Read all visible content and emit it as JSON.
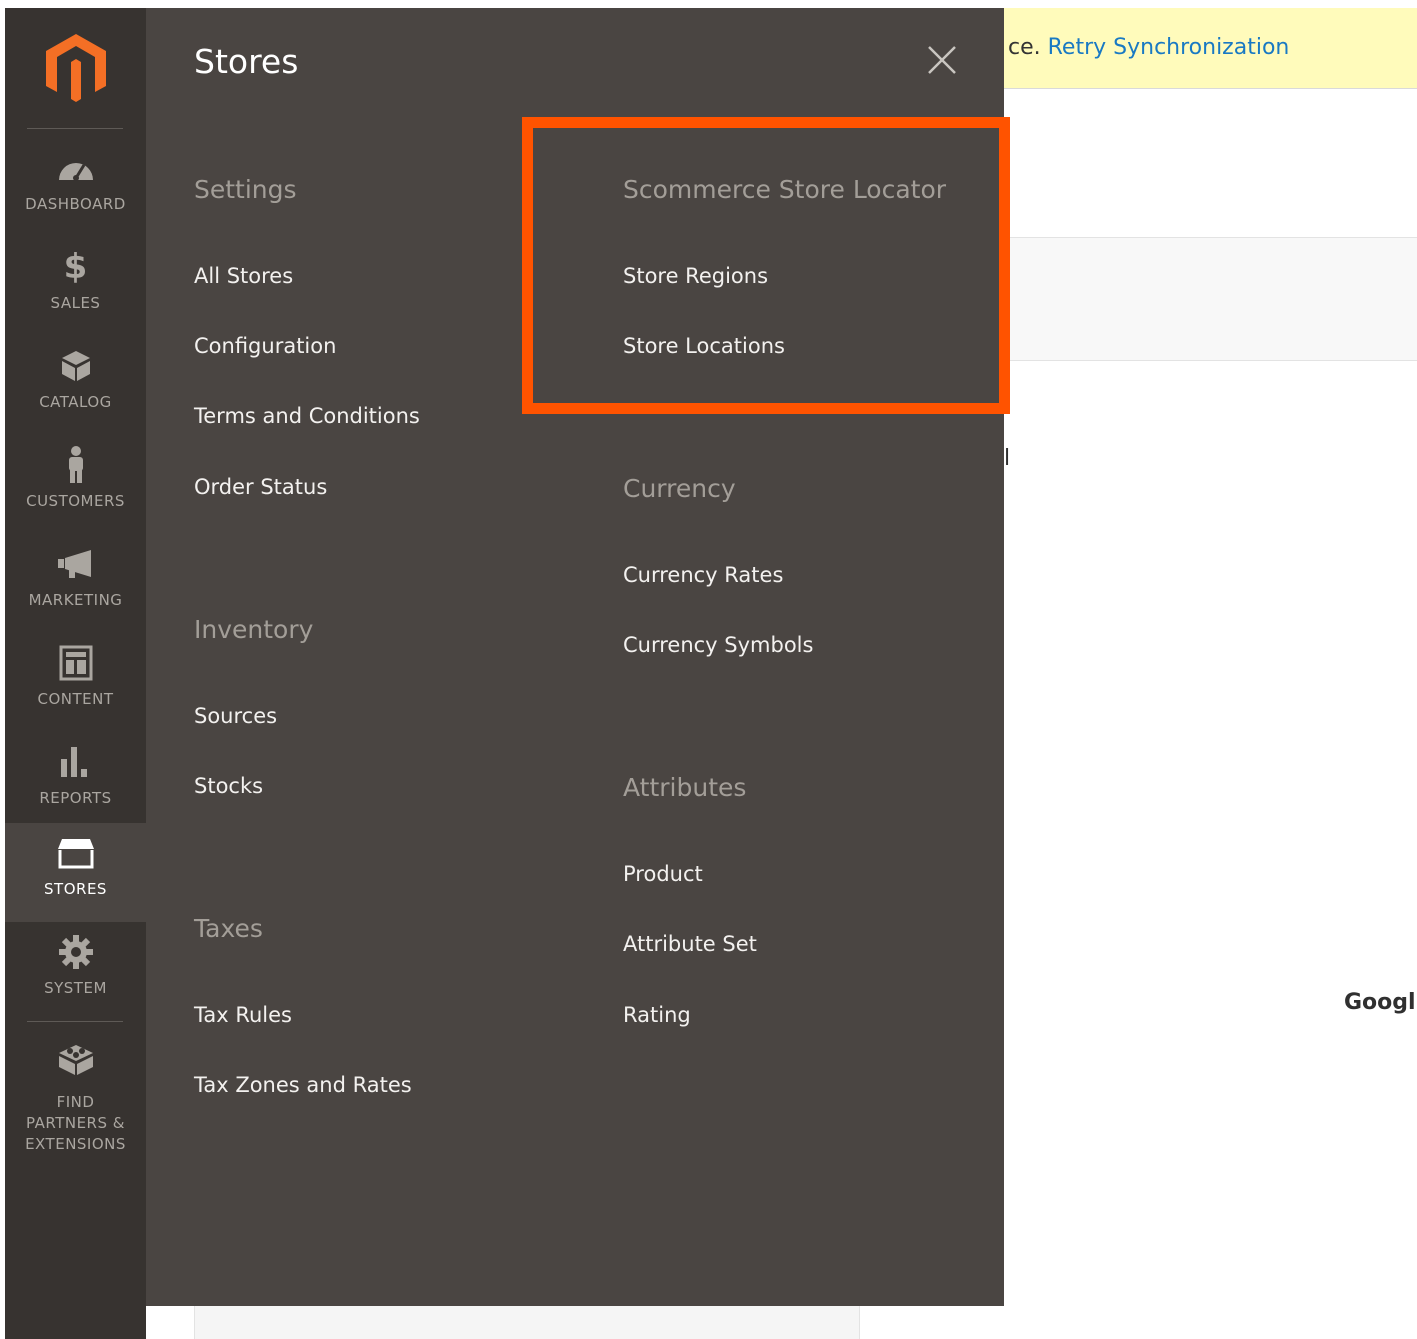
{
  "sidebar": {
    "items": [
      {
        "key": "dashboard",
        "label": "DASHBOARD",
        "icon": "dashboard-icon"
      },
      {
        "key": "sales",
        "label": "SALES",
        "icon": "dollar-icon"
      },
      {
        "key": "catalog",
        "label": "CATALOG",
        "icon": "catalog-box-icon"
      },
      {
        "key": "customers",
        "label": "CUSTOMERS",
        "icon": "person-icon"
      },
      {
        "key": "marketing",
        "label": "MARKETING",
        "icon": "megaphone-icon"
      },
      {
        "key": "content",
        "label": "CONTENT",
        "icon": "content-layout-icon"
      },
      {
        "key": "reports",
        "label": "REPORTS",
        "icon": "bar-chart-icon"
      },
      {
        "key": "stores",
        "label": "STORES",
        "icon": "storefront-icon",
        "active": true
      },
      {
        "key": "system",
        "label": "SYSTEM",
        "icon": "gear-icon"
      },
      {
        "key": "find_partners",
        "label_lines": [
          "FIND",
          "PARTNERS &",
          "EXTENSIONS"
        ],
        "icon": "extensions-icon"
      }
    ]
  },
  "flyout": {
    "title": "Stores",
    "groups": {
      "settings": {
        "title": "Settings",
        "links": [
          "All Stores",
          "Configuration",
          "Terms and Conditions",
          "Order Status"
        ]
      },
      "inventory": {
        "title": "Inventory",
        "links": [
          "Sources",
          "Stocks"
        ]
      },
      "taxes": {
        "title": "Taxes",
        "links": [
          "Tax Rules",
          "Tax Zones and Rates"
        ]
      },
      "store_locator": {
        "title": "Scommerce Store Locator",
        "links": [
          "Store Regions",
          "Store Locations"
        ]
      },
      "currency": {
        "title": "Currency",
        "links": [
          "Currency Rates",
          "Currency Symbols"
        ]
      },
      "attributes": {
        "title": "Attributes",
        "links": [
          "Product",
          "Attribute Set",
          "Rating"
        ]
      }
    }
  },
  "background": {
    "notice_prefix": "ce. ",
    "notice_link": "Retry Synchronization",
    "fragment_l": "l",
    "fragment_google": "Googl"
  },
  "colors": {
    "sidebar_bg": "#373330",
    "flyout_bg": "#4a4542",
    "highlight": "#ff5300",
    "logo_orange": "#f46f25",
    "link_blue": "#1979c3",
    "notice_bg": "#fffbbb"
  }
}
